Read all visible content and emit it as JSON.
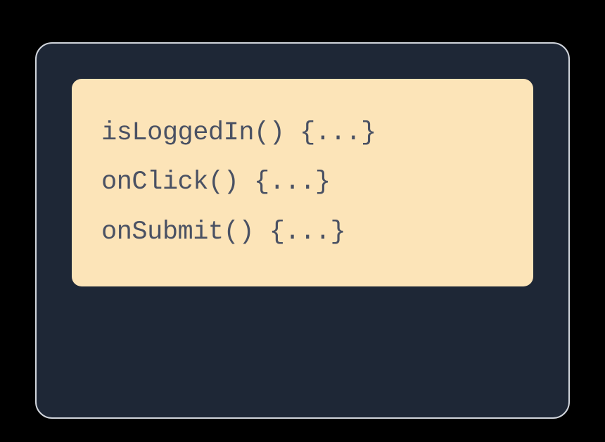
{
  "code": {
    "lines": [
      "isLoggedIn() {...}",
      "onClick() {...}",
      "onSubmit() {...}"
    ]
  },
  "colors": {
    "page_bg": "#000000",
    "panel_bg": "#1e2736",
    "panel_border": "#d0d4db",
    "code_bg": "#fce4b8",
    "code_text": "#4a5163"
  }
}
